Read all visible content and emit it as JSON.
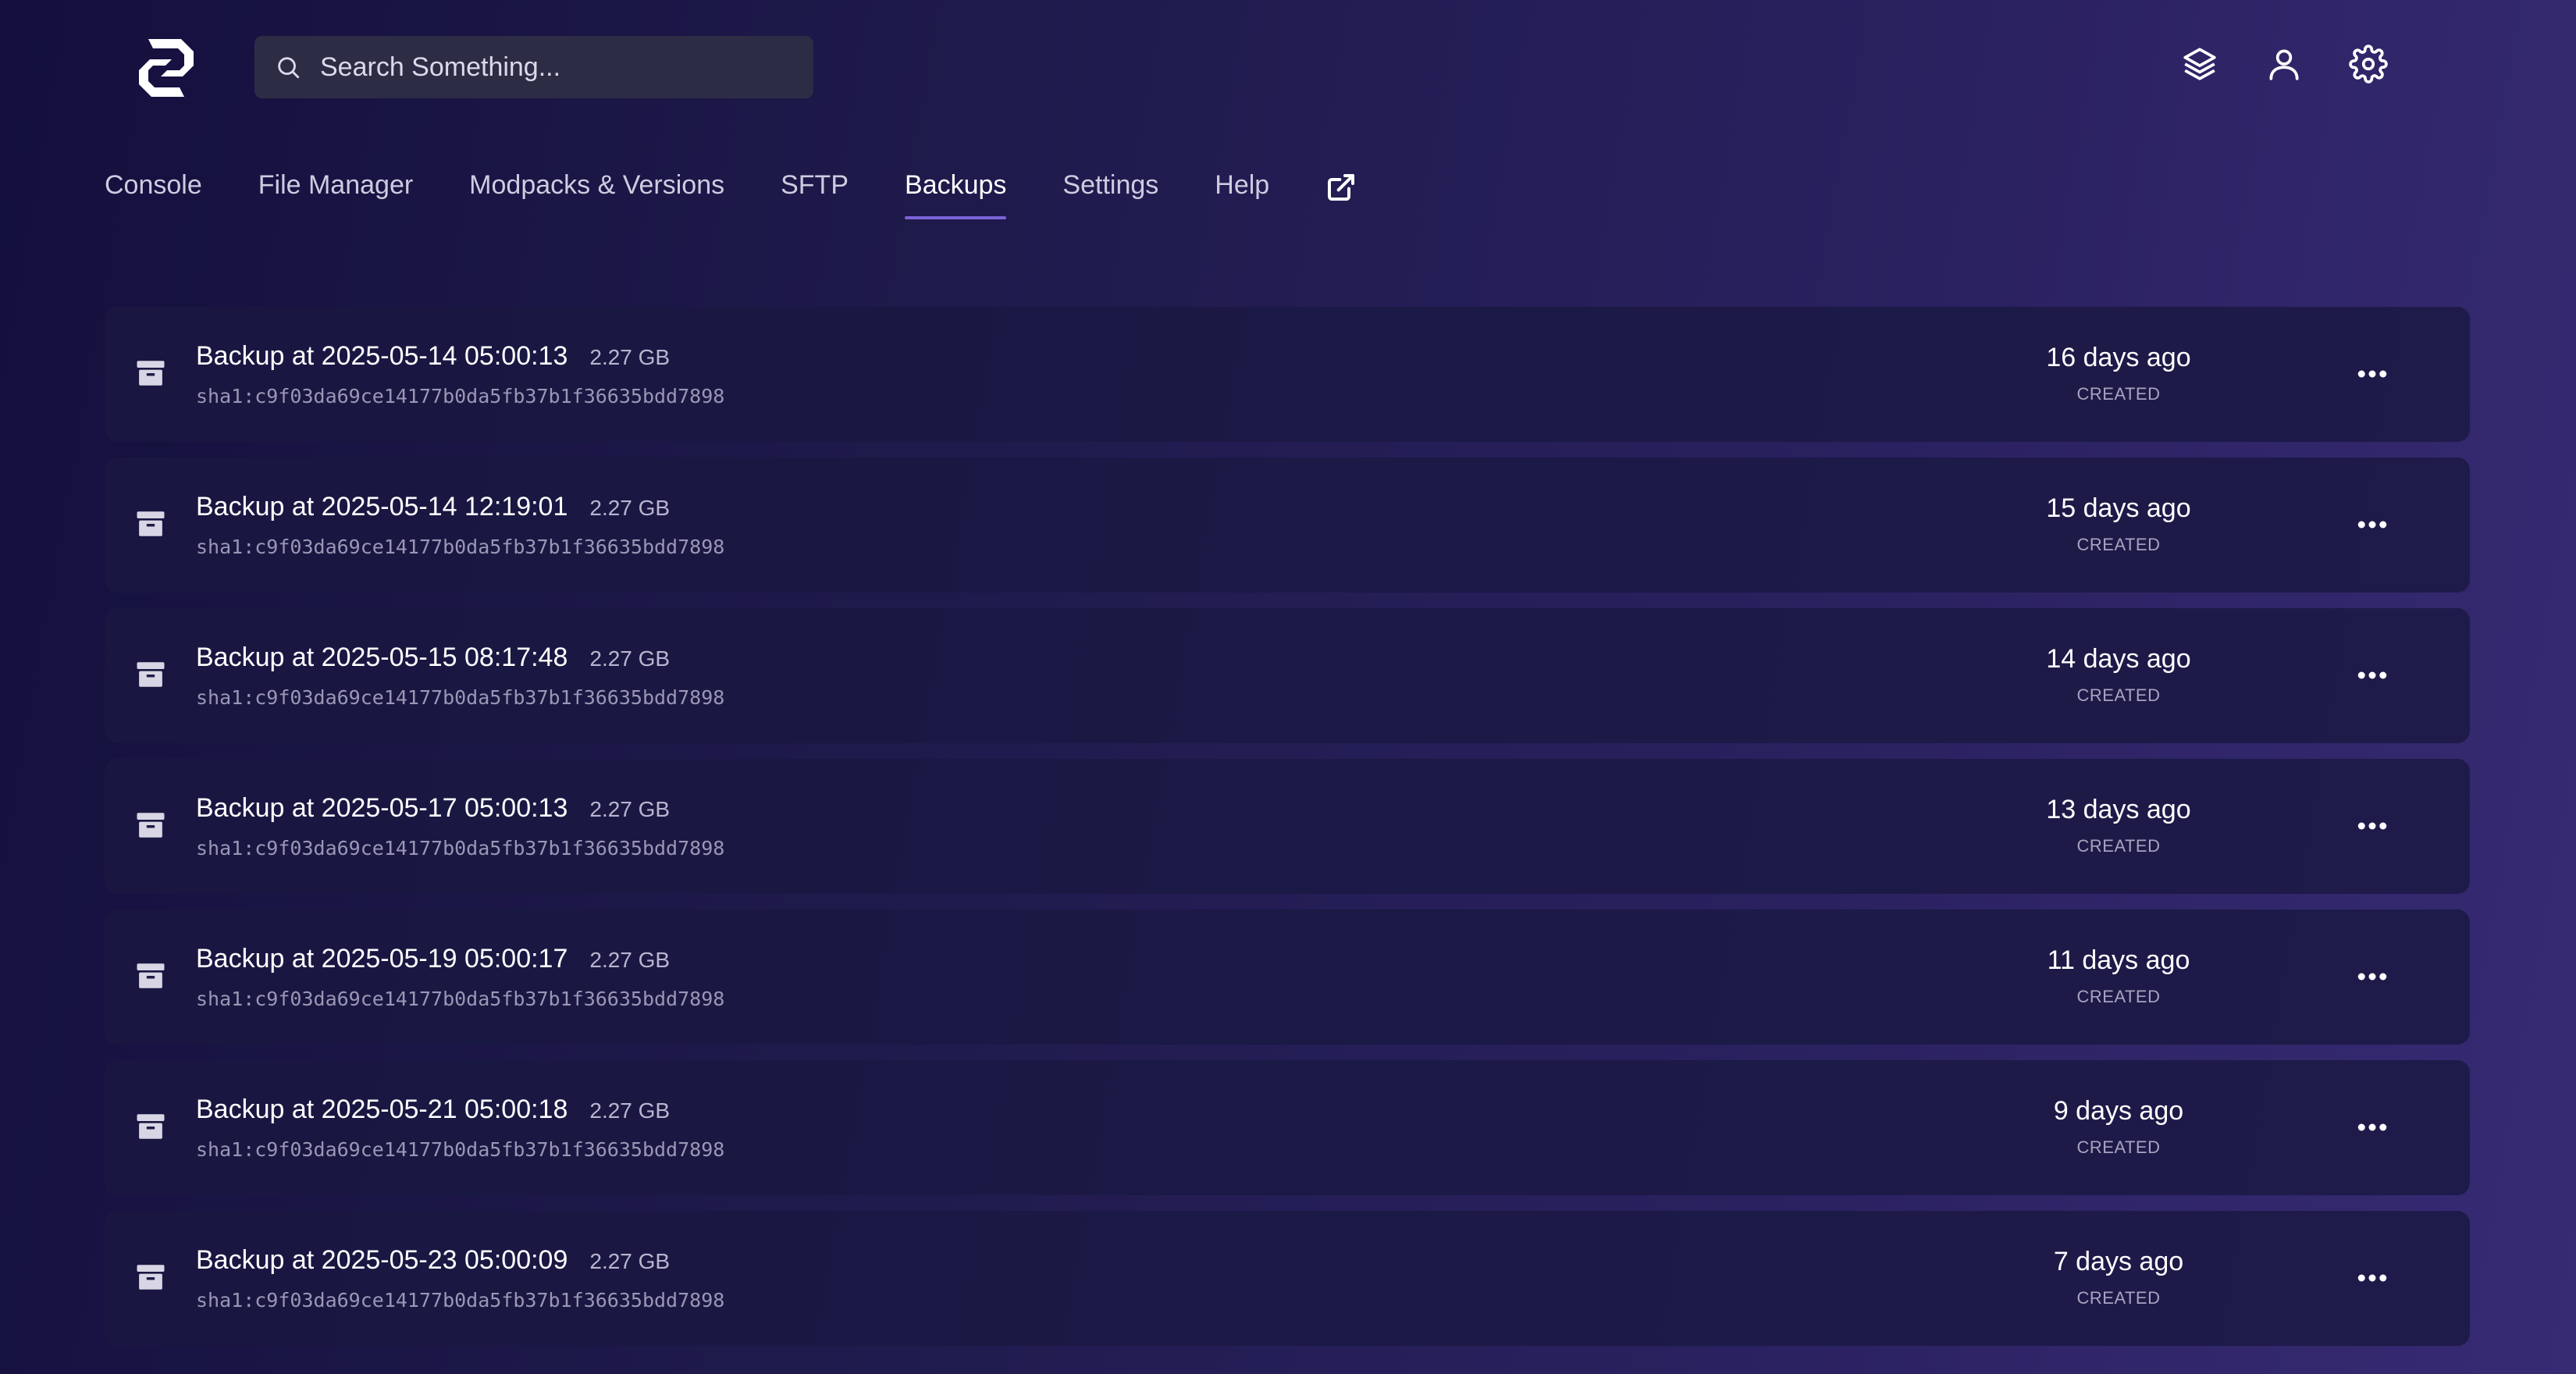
{
  "header": {
    "search_placeholder": "Search Something...",
    "icons": [
      "logo-icon",
      "search-icon",
      "layers-icon",
      "user-icon",
      "gear-icon"
    ]
  },
  "nav": {
    "items": [
      {
        "label": "Console",
        "active": false
      },
      {
        "label": "File Manager",
        "active": false
      },
      {
        "label": "Modpacks & Versions",
        "active": false
      },
      {
        "label": "SFTP",
        "active": false
      },
      {
        "label": "Backups",
        "active": true
      },
      {
        "label": "Settings",
        "active": false
      },
      {
        "label": "Help",
        "active": false
      }
    ],
    "external_icon": "external-link-icon"
  },
  "colors": {
    "accent": "#7b63d6",
    "background_start": "#140f3d",
    "background_end": "#372b74",
    "card": "#1a1842"
  },
  "backups": [
    {
      "name": "Backup at 2025-05-14 05:00:13",
      "size": "2.27 GB",
      "hash": "sha1:c9f03da69ce14177b0da5fb37b1f36635bdd7898",
      "ago": "16 days ago",
      "created_label": "CREATED"
    },
    {
      "name": "Backup at 2025-05-14 12:19:01",
      "size": "2.27 GB",
      "hash": "sha1:c9f03da69ce14177b0da5fb37b1f36635bdd7898",
      "ago": "15 days ago",
      "created_label": "CREATED"
    },
    {
      "name": "Backup at 2025-05-15 08:17:48",
      "size": "2.27 GB",
      "hash": "sha1:c9f03da69ce14177b0da5fb37b1f36635bdd7898",
      "ago": "14 days ago",
      "created_label": "CREATED"
    },
    {
      "name": "Backup at 2025-05-17 05:00:13",
      "size": "2.27 GB",
      "hash": "sha1:c9f03da69ce14177b0da5fb37b1f36635bdd7898",
      "ago": "13 days ago",
      "created_label": "CREATED"
    },
    {
      "name": "Backup at 2025-05-19 05:00:17",
      "size": "2.27 GB",
      "hash": "sha1:c9f03da69ce14177b0da5fb37b1f36635bdd7898",
      "ago": "11 days ago",
      "created_label": "CREATED"
    },
    {
      "name": "Backup at 2025-05-21 05:00:18",
      "size": "2.27 GB",
      "hash": "sha1:c9f03da69ce14177b0da5fb37b1f36635bdd7898",
      "ago": "9 days ago",
      "created_label": "CREATED"
    },
    {
      "name": "Backup at 2025-05-23 05:00:09",
      "size": "2.27 GB",
      "hash": "sha1:c9f03da69ce14177b0da5fb37b1f36635bdd7898",
      "ago": "7 days ago",
      "created_label": "CREATED"
    }
  ]
}
